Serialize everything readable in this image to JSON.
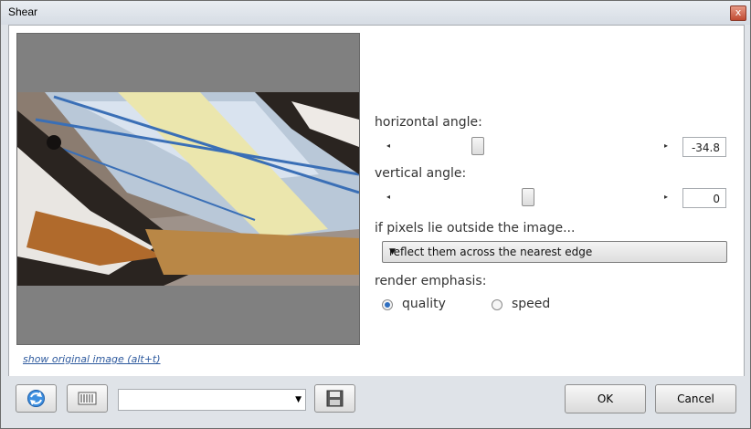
{
  "window": {
    "title": "Shear",
    "close_label": "x"
  },
  "preview": {
    "show_original_link": "show original image (alt+t)"
  },
  "controls": {
    "horizontal_angle": {
      "label": "horizontal angle:",
      "value": "-34.8"
    },
    "vertical_angle": {
      "label": "vertical angle:",
      "value": "0"
    },
    "edge_mode": {
      "label": "if pixels lie outside the image...",
      "selected": "reflect them across the nearest edge"
    },
    "render_emphasis": {
      "label": "render emphasis:",
      "options": [
        "quality",
        "speed"
      ],
      "selected": "quality"
    }
  },
  "footer": {
    "ok_label": "OK",
    "cancel_label": "Cancel",
    "preset_value": ""
  },
  "colors": {
    "accent": "#2f6fc0",
    "preview_bg": "#808080"
  }
}
